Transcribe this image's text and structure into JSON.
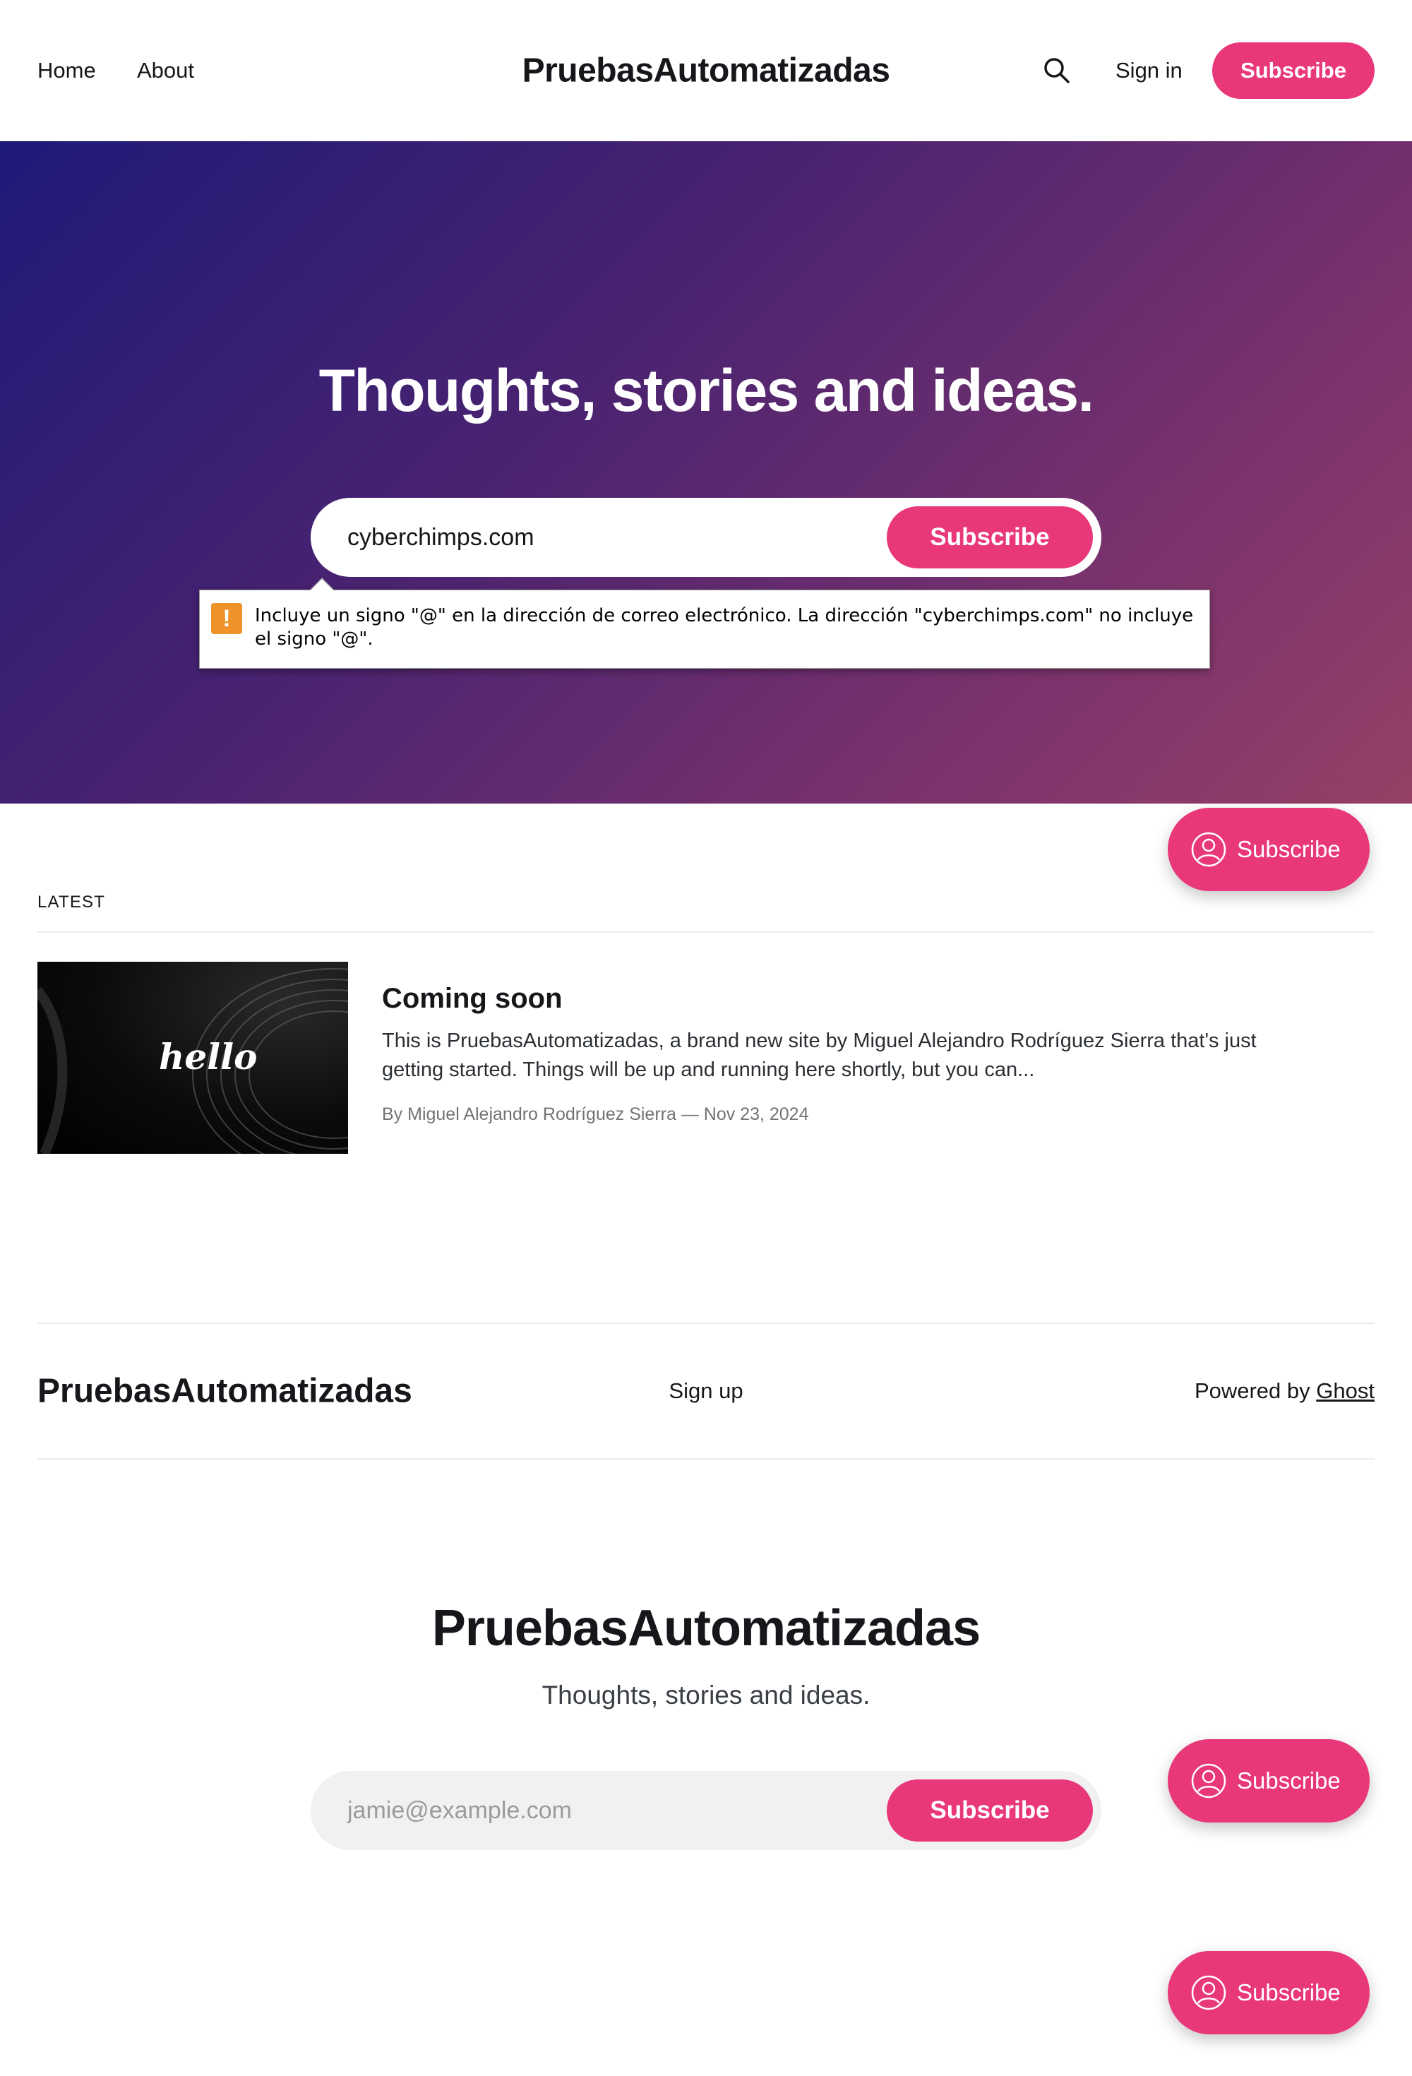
{
  "header": {
    "nav": [
      {
        "label": "Home"
      },
      {
        "label": "About"
      }
    ],
    "brand": "PruebasAutomatizadas",
    "search_icon": "search-icon",
    "signin_label": "Sign in",
    "subscribe_label": "Subscribe"
  },
  "hero": {
    "title": "Thoughts, stories and ideas.",
    "email_value": "cyberchimps.com",
    "submit_label": "Subscribe",
    "validation_tooltip": {
      "icon": "warning-icon",
      "icon_glyph": "!",
      "message": "Incluye un signo \"@\" en la dirección de correo electrónico. La dirección \"cyberchimps.com\" no incluye el signo \"@\"."
    }
  },
  "portal_button": {
    "label": "Subscribe",
    "icon": "user-circle-icon"
  },
  "latest": {
    "section_label": "LATEST",
    "posts": [
      {
        "title": "Coming soon",
        "excerpt": "This is PruebasAutomatizadas, a brand new site by Miguel Alejandro Rodríguez Sierra that's just getting started. Things will be up and running here shortly, but you can...",
        "meta": "By Miguel Alejandro Rodríguez Sierra — Nov 23, 2024",
        "thumbnail_text": "hello"
      }
    ]
  },
  "footer": {
    "brand": "PruebasAutomatizadas",
    "signup_label": "Sign up",
    "powered_by": "Powered by",
    "powered_link": "Ghost"
  },
  "cta": {
    "title": "PruebasAutomatizadas",
    "subtitle": "Thoughts, stories and ideas.",
    "email_placeholder": "jamie@example.com",
    "submit_label": "Subscribe"
  },
  "colors": {
    "accent": "#e9387a",
    "hero_gradient_start": "#1e1a78",
    "hero_gradient_end": "#964066",
    "warning": "#f0922a"
  }
}
